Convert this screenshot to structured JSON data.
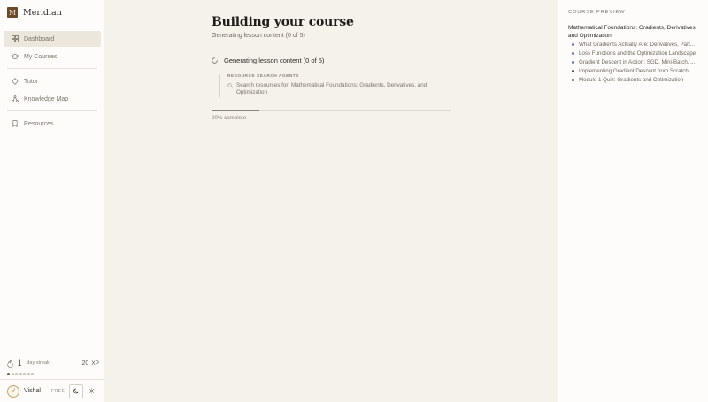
{
  "app": {
    "name": "Meridian",
    "logo_letter": "M"
  },
  "sidebar": {
    "items": [
      {
        "label": "Dashboard",
        "icon": "grid-icon",
        "active": true
      },
      {
        "label": "My Courses",
        "icon": "graduation-cap-icon",
        "active": false
      },
      {
        "label": "Tutor",
        "icon": "diamond-icon",
        "active": false
      },
      {
        "label": "Knowledge Map",
        "icon": "network-icon",
        "active": false
      },
      {
        "label": "Resources",
        "icon": "bookmark-icon",
        "active": false
      }
    ],
    "streak": {
      "count": "1",
      "label": "day streak",
      "xp_value": "20",
      "xp_label": "XP",
      "dots_filled": 1,
      "dots_total": 7
    },
    "user": {
      "avatar_letter": "V",
      "name": "Vishal",
      "plan": "FREE"
    }
  },
  "main": {
    "title": "Building your course",
    "subtitle": "Generating lesson content (0 of 5)",
    "step_text": "Generating lesson content (0 of 5)",
    "agents_label": "RESOURCE SEARCH AGENTS",
    "agent_query": "Search resources for: Mathematical Foundations: Gradients, Derivatives, and Optimization",
    "progress_fraction": 0.2,
    "progress_label": "20% complete"
  },
  "preview": {
    "label": "COURSE PREVIEW",
    "module_title": "Mathematical Foundations: Gradients, Derivatives, and Optimization",
    "lessons": [
      {
        "title": "What Gradients Actually Are: Derivatives, Part...",
        "color": "#5b72b0"
      },
      {
        "title": "Loss Functions and the Optimization Landscape",
        "color": "#5b72b0"
      },
      {
        "title": "Gradient Descent in Action: SGD, Mini-Batch, ...",
        "color": "#5b72b0"
      },
      {
        "title": "Implementing Gradient Descent from Scratch",
        "color": "#4a4a4a"
      },
      {
        "title": "Module 1 Quiz: Gradients and Optimization",
        "color": "#4a4a4a"
      }
    ]
  },
  "colors": {
    "accent_brown": "#6b4a2b",
    "lesson_bullet_blue": "#5b72b0"
  }
}
